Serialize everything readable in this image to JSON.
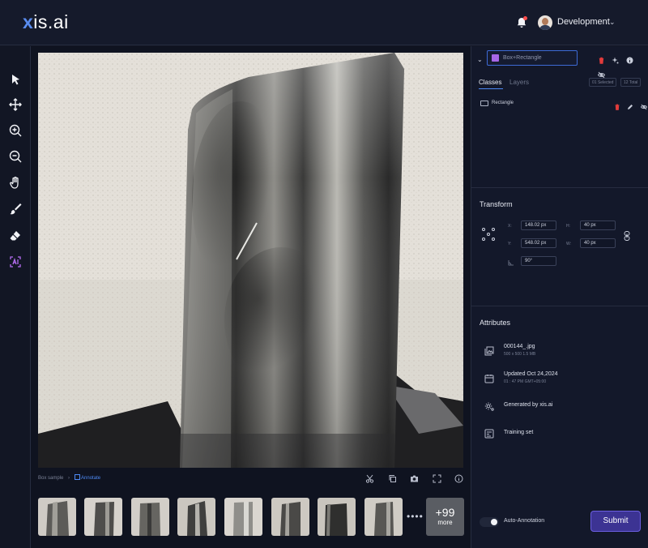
{
  "app": {
    "logo_prefix": "x",
    "logo_rest": "is.ai"
  },
  "header": {
    "workspace": "Development"
  },
  "breadcrumb": {
    "parent": "Box sample",
    "separator": "›",
    "current": "Annotate"
  },
  "thumbnails": {
    "more_count": "+99",
    "more_label": "more",
    "dots": "••••"
  },
  "panel": {
    "class_select_value": "Box+Rectangle",
    "class_color": "#a766e6",
    "tabs": {
      "classes": "Classes",
      "layers": "Layers"
    },
    "chips": {
      "selected": "01 Selected",
      "total": "12 Total"
    },
    "class_items": [
      {
        "label": "Rectangle"
      }
    ]
  },
  "transform": {
    "title": "Transform",
    "x_label": "X:",
    "x_value": "148.02 px",
    "y_label": "Y:",
    "y_value": "548.02 px",
    "h_label": "H:",
    "h_value": "40 px",
    "w_label": "W:",
    "w_value": "40 px",
    "angle_value": "90°"
  },
  "attributes": {
    "title": "Attributes",
    "file_name": "000144_.jpg",
    "file_meta": "500 x 500    1.5 MB",
    "updated": "Updated Oct 24,2024",
    "updated_meta": "01 : 47 PM    GMT+05:00",
    "generated": "Generated by xis.ai",
    "dataset": "Training set"
  },
  "footer": {
    "auto_annotation": "Auto-Annotation",
    "submit": "Submit"
  },
  "colors": {
    "accent": "#4e8af5",
    "submit_bg": "#3c3393",
    "delete_red": "#e23b3b",
    "ai_purple": "#b46cf0"
  }
}
